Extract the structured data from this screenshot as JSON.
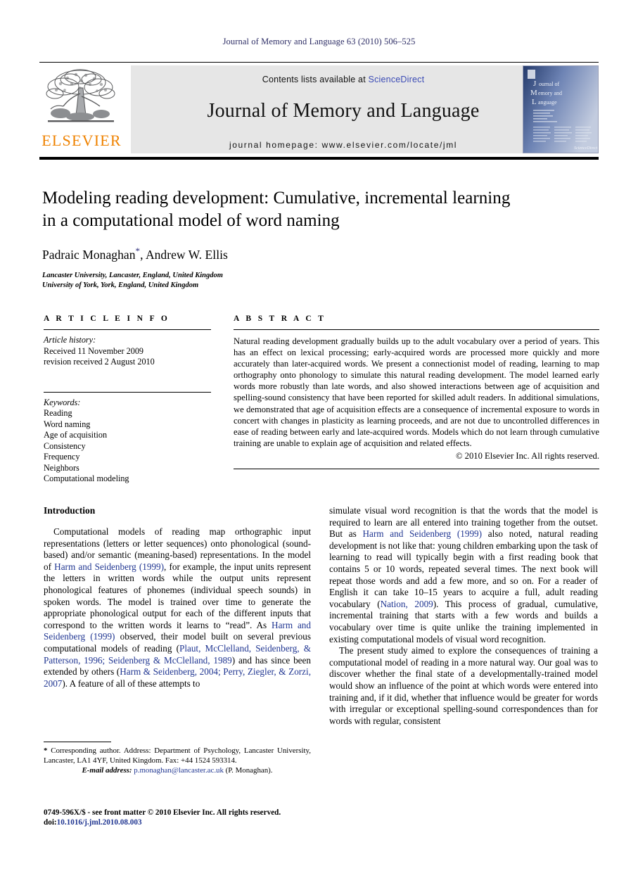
{
  "running_head": "Journal of Memory and Language 63 (2010) 506–525",
  "masthead": {
    "contents_prefix": "Contents lists available at ",
    "sciencedirect": "ScienceDirect",
    "journal_title": "Journal of Memory and Language",
    "homepage": "journal homepage: www.elsevier.com/locate/jml",
    "publisher_wordmark": "ELSEVIER",
    "publisher_logo_name": "elsevier-tree-logo",
    "cover_title_lines": [
      "Journal of",
      "Memory and",
      "Language"
    ],
    "colors": {
      "band_background": "#e6e6e6",
      "link": "#3b4bb5",
      "elsevier_orange": "#ef8200",
      "running_head": "#2e2e66"
    }
  },
  "title_block": {
    "title_line_1": "Modeling reading development: Cumulative, incremental learning",
    "title_line_2": "in a computational model of word naming",
    "authors": "Padraic Monaghan",
    "author_marker": "*",
    "authors_rest": ", Andrew W. Ellis",
    "affiliations": [
      "Lancaster University, Lancaster, England, United Kingdom",
      "University of York, York, England, United Kingdom"
    ]
  },
  "article_info": {
    "heading": "A R T I C L E    I N F O",
    "history_label": "Article history:",
    "history_lines": [
      "Received 11 November 2009",
      "revision received 2 August 2010"
    ],
    "keywords_label": "Keywords:",
    "keywords": [
      "Reading",
      "Word naming",
      "Age of acquisition",
      "Consistency",
      "Frequency",
      "Neighbors",
      "Computational modeling"
    ]
  },
  "abstract": {
    "heading": "A B S T R A C T",
    "text": "Natural reading development gradually builds up to the adult vocabulary over a period of years. This has an effect on lexical processing; early-acquired words are processed more quickly and more accurately than later-acquired words. We present a connectionist model of reading, learning to map orthography onto phonology to simulate this natural reading development. The model learned early words more robustly than late words, and also showed interactions between age of acquisition and spelling-sound consistency that have been reported for skilled adult readers. In additional simulations, we demonstrated that age of acquisition effects are a consequence of incremental exposure to words in concert with changes in plasticity as learning proceeds, and are not due to uncontrolled differences in ease of reading between early and late-acquired words. Models which do not learn through cumulative training are unable to explain age of acquisition and related effects.",
    "copyright": "© 2010 Elsevier Inc. All rights reserved."
  },
  "body": {
    "section_heading": "Introduction",
    "left_paragraph_1_a": "Computational models of reading map orthographic input representations (letters or letter sequences) onto phonological (sound-based) and/or semantic (meaning-based) representations. In the model of ",
    "left_ref_1": "Harm and Seidenberg (1999)",
    "left_paragraph_1_b": ", for example, the input units represent the letters in written words while the output units represent phonological features of phonemes (individual speech sounds) in spoken words. The model is trained over time to generate the appropriate phonological output for each of the different inputs that correspond to the written words it learns to “read”. As ",
    "left_ref_2": "Harm and Seidenberg (1999)",
    "left_paragraph_1_c": " observed, their model built on several previous computational models of reading (",
    "left_ref_3": "Plaut, McClelland, Seidenberg, & Patterson, 1996; Seidenberg & McClelland, 1989",
    "left_paragraph_1_d": ") and has since been extended by others (",
    "left_ref_4": "Harm & Seidenberg, 2004; Perry, Ziegler, & Zorzi, 2007",
    "left_paragraph_1_e": "). A feature of all of these attempts to",
    "right_paragraph_1_a": "simulate visual word recognition is that the words that the model is required to learn are all entered into training together from the outset. But as ",
    "right_ref_1": "Harm and Seidenberg (1999)",
    "right_paragraph_1_b": " also noted, natural reading development is not like that: young children embarking upon the task of learning to read will typically begin with a first reading book that contains 5 or 10 words, repeated several times. The next book will repeat those words and add a few more, and so on. For a reader of English it can take 10–15 years to acquire a full, adult reading vocabulary (",
    "right_ref_2": "Nation, 2009",
    "right_paragraph_1_c": "). This process of gradual, cumulative, incremental training that starts with a few words and builds a vocabulary over time is quite unlike the training implemented in existing computational models of visual word recognition.",
    "right_paragraph_2": "The present study aimed to explore the consequences of training a computational model of reading in a more natural way. Our goal was to discover whether the final state of a developmentally-trained model would show an influence of the point at which words were entered into training and, if it did, whether that influence would be greater for words with irregular or exceptional spelling-sound correspondences than for words with regular, consistent"
  },
  "footnote": {
    "marker": "*",
    "text": " Corresponding author. Address: Department of Psychology, Lancaster University, Lancaster, LA1 4YF, United Kingdom. Fax: +44 1524 593314.",
    "email_label": "E-mail address:",
    "email": "p.monaghan@lancaster.ac.uk",
    "email_suffix": " (P. Monaghan)."
  },
  "imprint": {
    "line_1": "0749-596X/$ - see front matter © 2010 Elsevier Inc. All rights reserved.",
    "doi_label": "doi:",
    "doi": "10.1016/j.jml.2010.08.003"
  }
}
